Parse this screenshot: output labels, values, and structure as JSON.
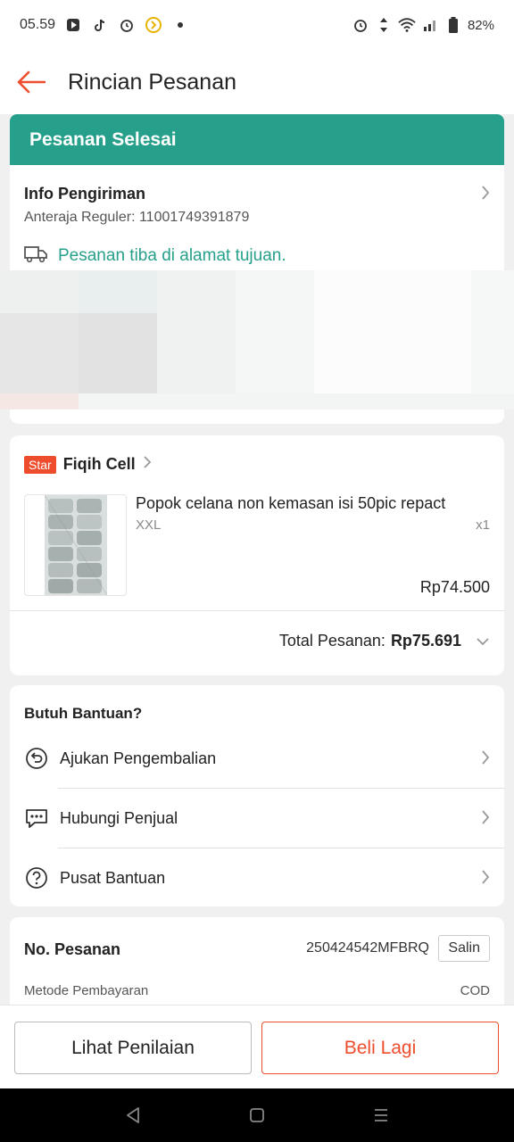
{
  "status_bar": {
    "time": "05.59",
    "battery": "82%"
  },
  "header": {
    "title": "Rincian Pesanan"
  },
  "order_status": {
    "label": "Pesanan Selesai"
  },
  "shipping": {
    "title": "Info Pengiriman",
    "courier": "Anteraja Reguler: 11001749391879",
    "status": "Pesanan tiba di alamat tujuan."
  },
  "shop": {
    "badge": "Star",
    "name": "Fiqih Cell",
    "product": {
      "name": "Popok celana non kemasan isi 50pic repact",
      "variant": "XXL",
      "quantity": "x1",
      "price": "Rp74.500"
    },
    "total_label": "Total Pesanan:",
    "total_value": "Rp75.691"
  },
  "help": {
    "title": "Butuh Bantuan?",
    "items": [
      {
        "label": "Ajukan Pengembalian",
        "icon": "return-icon"
      },
      {
        "label": "Hubungi Penjual",
        "icon": "chat-icon"
      },
      {
        "label": "Pusat Bantuan",
        "icon": "help-icon"
      }
    ]
  },
  "order_info": {
    "number_label": "No. Pesanan",
    "number": "250424542MFBRQ",
    "copy_label": "Salin",
    "payment_label": "Metode Pembayaran",
    "payment_value": "COD"
  },
  "actions": {
    "review_label": "Lihat Penilaian",
    "buy_again_label": "Beli Lagi"
  },
  "colors": {
    "accent": "#ee4d2d",
    "success": "#26a08a"
  }
}
